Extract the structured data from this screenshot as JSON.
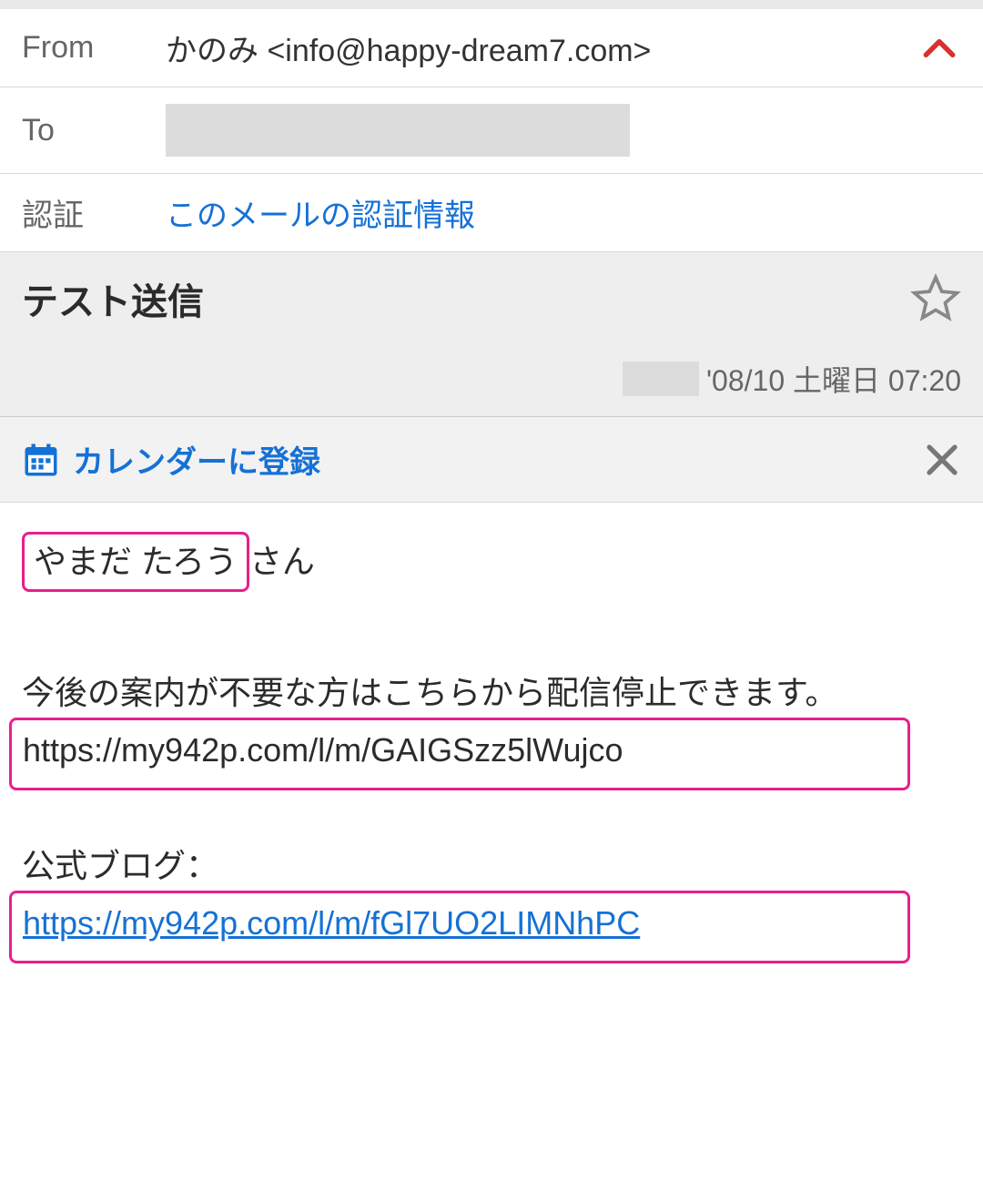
{
  "header": {
    "from_label": "From",
    "from_value": "かのみ <info@happy-dream7.com>",
    "to_label": "To",
    "auth_label": "認証",
    "auth_link": "このメールの認証情報"
  },
  "subject": {
    "text": "テスト送信",
    "date": "'08/10 土曜日 07:20"
  },
  "calendar": {
    "register_label": "カレンダーに登録"
  },
  "body": {
    "greeting_highlighted": "やまだ たろう",
    "greeting_suffix": "さん",
    "unsubscribe_text": "今後の案内が不要な方はこちらから配信停止できます。",
    "unsubscribe_url": "https://my942p.com/l/m/GAIGSzz5lWujco",
    "blog_label": "公式ブログ：",
    "blog_url": "https://my942p.com/l/m/fGl7UO2LIMNhPC"
  }
}
